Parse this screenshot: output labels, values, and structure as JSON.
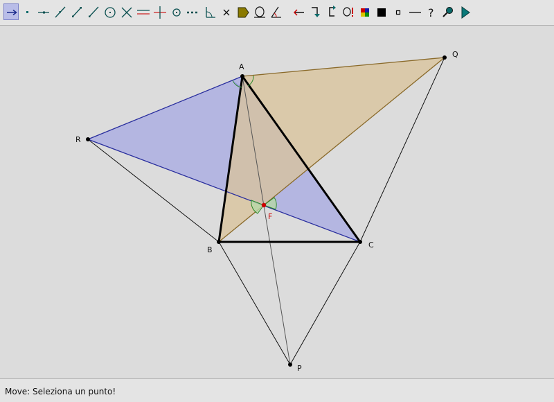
{
  "toolbar": {
    "tools": [
      {
        "name": "move",
        "selected": true
      },
      {
        "name": "new-point"
      },
      {
        "name": "intersect"
      },
      {
        "name": "line"
      },
      {
        "name": "segment"
      },
      {
        "name": "ray"
      },
      {
        "name": "circle"
      },
      {
        "name": "cross"
      },
      {
        "name": "parallel"
      },
      {
        "name": "perpendicular"
      },
      {
        "name": "center-circle"
      },
      {
        "name": "dotted-line"
      },
      {
        "name": "angle-tool"
      },
      {
        "name": "delete"
      },
      {
        "name": "polygon"
      },
      {
        "name": "locus"
      },
      {
        "name": "angle-measure"
      },
      {
        "name": "arrow-left"
      },
      {
        "name": "redo-arrow"
      },
      {
        "name": "undo-arrow"
      },
      {
        "name": "macro"
      },
      {
        "name": "color-palette"
      },
      {
        "name": "fill-square"
      },
      {
        "name": "small-square"
      },
      {
        "name": "line-style"
      },
      {
        "name": "help"
      },
      {
        "name": "zoom"
      },
      {
        "name": "play"
      }
    ]
  },
  "points": {
    "A": "A",
    "B": "B",
    "C": "C",
    "P": "P",
    "Q": "Q",
    "R": "R",
    "F": "F"
  },
  "colors": {
    "blue_fill": "#a7a9e3",
    "tan_fill": "#d9c39a",
    "blue_edge": "#2a2f9e",
    "tan_edge": "#8a6a2a",
    "fermat_point": "#cc0000",
    "angle_mark": "#2c8a2c"
  },
  "status": {
    "text": "Move: Seleziona un punto!"
  }
}
